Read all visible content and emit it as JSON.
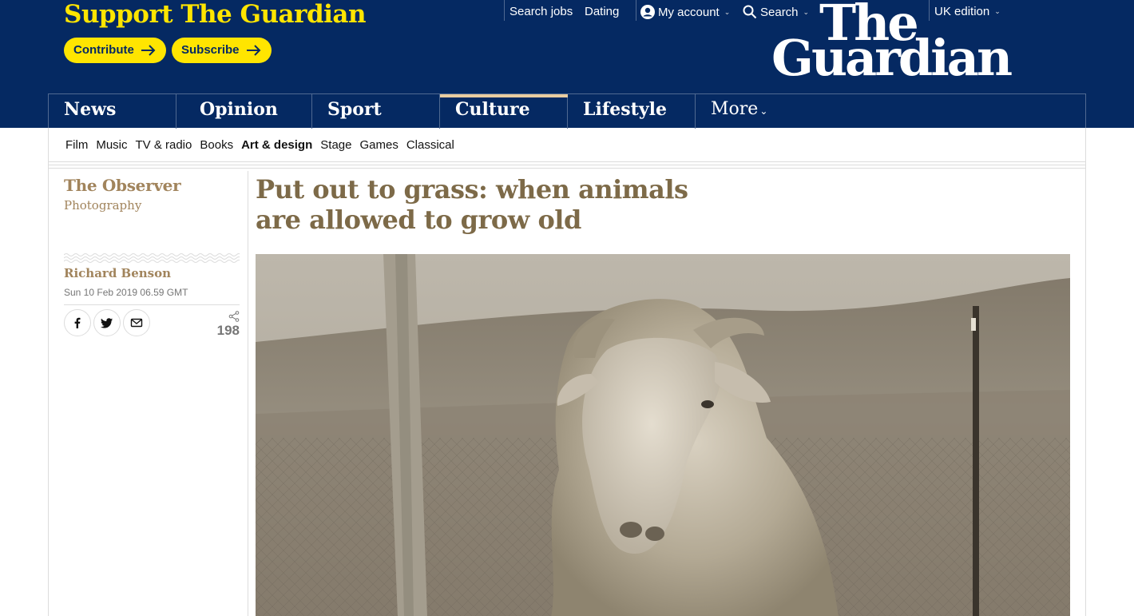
{
  "header": {
    "support_title": "Support The Guardian",
    "contribute_label": "Contribute",
    "subscribe_label": "Subscribe",
    "search_jobs": "Search jobs",
    "dating": "Dating",
    "my_account": "My account",
    "search": "Search",
    "edition": "UK edition",
    "logo_line1": "The",
    "logo_line2": "Guardian"
  },
  "pillars": [
    {
      "label": "News",
      "active": false
    },
    {
      "label": "Opinion",
      "active": false
    },
    {
      "label": "Sport",
      "active": false
    },
    {
      "label": "Culture",
      "active": true
    },
    {
      "label": "Lifestyle",
      "active": false
    },
    {
      "label": "More",
      "active": false
    }
  ],
  "subnav": {
    "items": [
      "Film",
      "Music",
      "TV & radio",
      "Books",
      "Art & design",
      "Stage",
      "Games",
      "Classical"
    ],
    "current": "Art & design"
  },
  "article": {
    "series": "The Observer",
    "series_sub": "Photography",
    "byline": "Richard Benson",
    "dateline": "Sun 10 Feb 2019 06.59 GMT",
    "share_count": "198",
    "headline": "Put out to grass: when animals are allowed to grow old"
  },
  "colors": {
    "brand_blue": "#052962",
    "support_yellow": "#ffe500",
    "culture_accent": "#eacca0",
    "culture_headline": "#7d6a48",
    "observer_gold": "#a1845c"
  },
  "icons": {
    "share_buttons": [
      "facebook-icon",
      "twitter-icon",
      "email-icon"
    ],
    "share_count_icon": "share-icon",
    "account_icon": "account-icon",
    "search_icon": "search-icon"
  }
}
